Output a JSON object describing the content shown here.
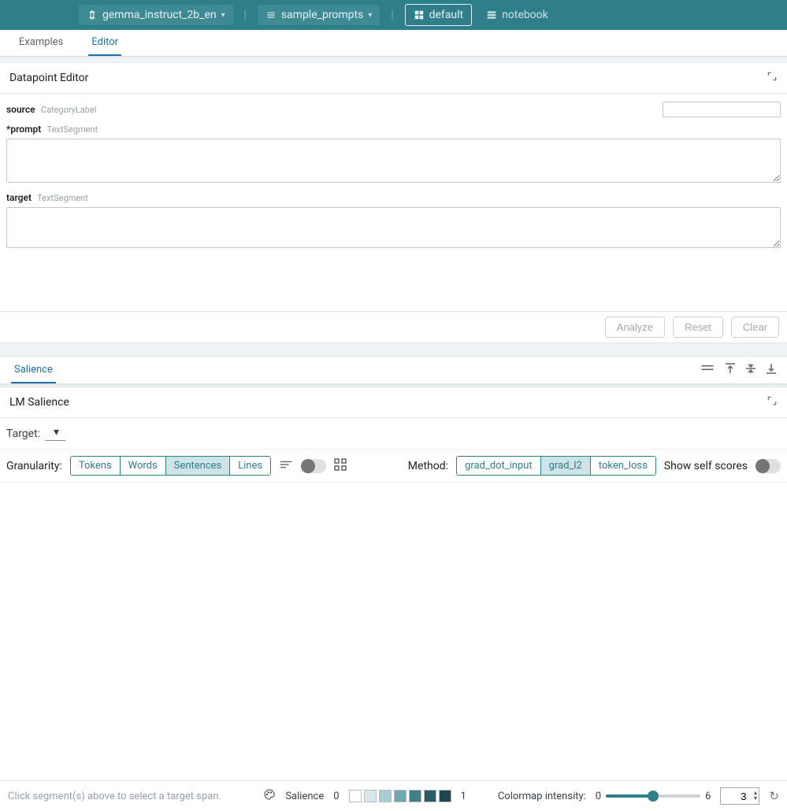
{
  "topbar": {
    "model": "gemma_instruct_2b_en",
    "dataset": "sample_prompts",
    "layout_default": "default",
    "layout_notebook": "notebook"
  },
  "tabs": {
    "examples": "Examples",
    "editor": "Editor"
  },
  "editor_panel": {
    "title": "Datapoint Editor",
    "fields": {
      "source": {
        "label": "source",
        "type": "CategoryLabel",
        "value": ""
      },
      "prompt": {
        "label": "*prompt",
        "type": "TextSegment",
        "value": ""
      },
      "target": {
        "label": "target",
        "type": "TextSegment",
        "value": ""
      }
    },
    "actions": {
      "analyze": "Analyze",
      "reset": "Reset",
      "clear": "Clear"
    }
  },
  "salience_panel": {
    "tab": "Salience",
    "title": "LM Salience",
    "target_label": "Target:",
    "granularity_label": "Granularity:",
    "granularity_options": [
      "Tokens",
      "Words",
      "Sentences",
      "Lines"
    ],
    "granularity_selected": "Sentences",
    "method_label": "Method:",
    "method_options": [
      "grad_dot_input",
      "grad_l2",
      "token_loss"
    ],
    "method_selected": "grad_l2",
    "show_self_label": "Show self scores"
  },
  "footer": {
    "hint": "Click segment(s) above to select a target span.",
    "salience_label": "Salience",
    "scale_min": "0",
    "scale_max": "1",
    "colormap_label": "Colormap intensity:",
    "cmap_min": "0",
    "cmap_max": "6",
    "cmap_value": "3",
    "swatches": [
      "#ffffff",
      "#d6e8ea",
      "#a7ced3",
      "#6fa9b1",
      "#3f7f8a",
      "#2a5c66",
      "#1e4650"
    ]
  }
}
